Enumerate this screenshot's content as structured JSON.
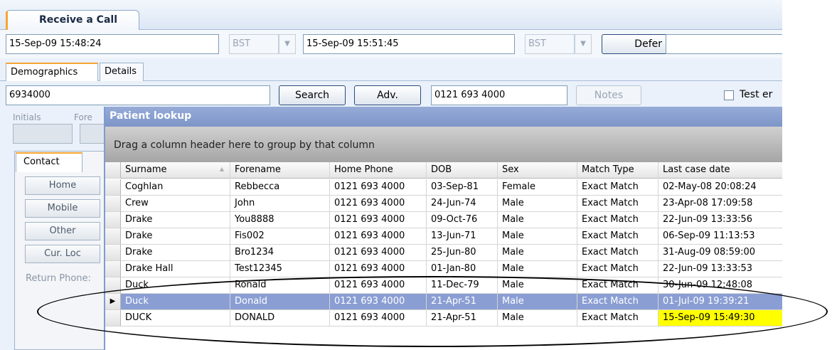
{
  "window": {
    "main_tab": "Receive a Call"
  },
  "datebar": {
    "start_datetime": "15-Sep-09 15:48:24",
    "start_tz": "BST",
    "end_datetime": "15-Sep-09 15:51:45",
    "end_tz": "BST",
    "defer_label": "Defer"
  },
  "subtabs": [
    "Demographics",
    "Details"
  ],
  "search": {
    "query": "6934000",
    "search_label": "Search",
    "adv_label": "Adv.",
    "phone": "0121 693 4000",
    "notes_label": "Notes",
    "test_label": "Test er"
  },
  "left": {
    "initials_label": "Initials",
    "forename_label": "Fore",
    "contact_tab": "Contact",
    "buttons": [
      "Home",
      "Mobile",
      "Other",
      "Cur. Loc"
    ],
    "return_phone_label": "Return Phone:"
  },
  "lookup": {
    "title": "Patient lookup",
    "group_hint": "Drag a column header here to group by that column",
    "columns": [
      "Surname",
      "Forename",
      "Home Phone",
      "DOB",
      "Sex",
      "Match Type",
      "Last case date"
    ],
    "rows": [
      [
        "Coghlan",
        "Rebbecca",
        "0121 693 4000",
        "03-Sep-81",
        "Female",
        "Exact Match",
        "02-May-08 20:08:24"
      ],
      [
        "Crew",
        "John",
        "0121 693 4000",
        "24-Jun-74",
        "Male",
        "Exact Match",
        "23-Apr-08 17:09:58"
      ],
      [
        "Drake",
        "You8888",
        "0121 693 4000",
        "09-Oct-76",
        "Male",
        "Exact Match",
        "22-Jun-09 13:33:56"
      ],
      [
        "Drake",
        "Fis002",
        "0121 693 4000",
        "13-Jun-71",
        "Male",
        "Exact Match",
        "06-Sep-09 11:13:53"
      ],
      [
        "Drake",
        "Bro1234",
        "0121 693 4000",
        "25-Jun-80",
        "Male",
        "Exact Match",
        "31-Aug-09 08:59:00"
      ],
      [
        "Drake Hall",
        "Test12345",
        "0121 693 4000",
        "01-Jan-80",
        "Male",
        "Exact Match",
        "22-Jun-09 13:33:53"
      ],
      [
        "Duck",
        "Ronald",
        "0121 693 4000",
        "11-Dec-79",
        "Male",
        "Exact Match",
        "30-Jun-09 12:48:08"
      ],
      [
        "Duck",
        "Donald",
        "0121 693 4000",
        "21-Apr-51",
        "Male",
        "Exact Match",
        "01-Jul-09 19:39:21"
      ],
      [
        "DUCK",
        "DONALD",
        "0121 693 4000",
        "21-Apr-51",
        "Male",
        "Exact Match",
        "15-Sep-09 15:49:30"
      ]
    ],
    "selected_row": 7,
    "highlight": {
      "row": 8,
      "col": 6,
      "color": "#ffff00"
    }
  },
  "colors": {
    "accent_orange": "#f7a434",
    "title_blue": "#7d95c8",
    "selected_row": "#8a9ed3"
  }
}
